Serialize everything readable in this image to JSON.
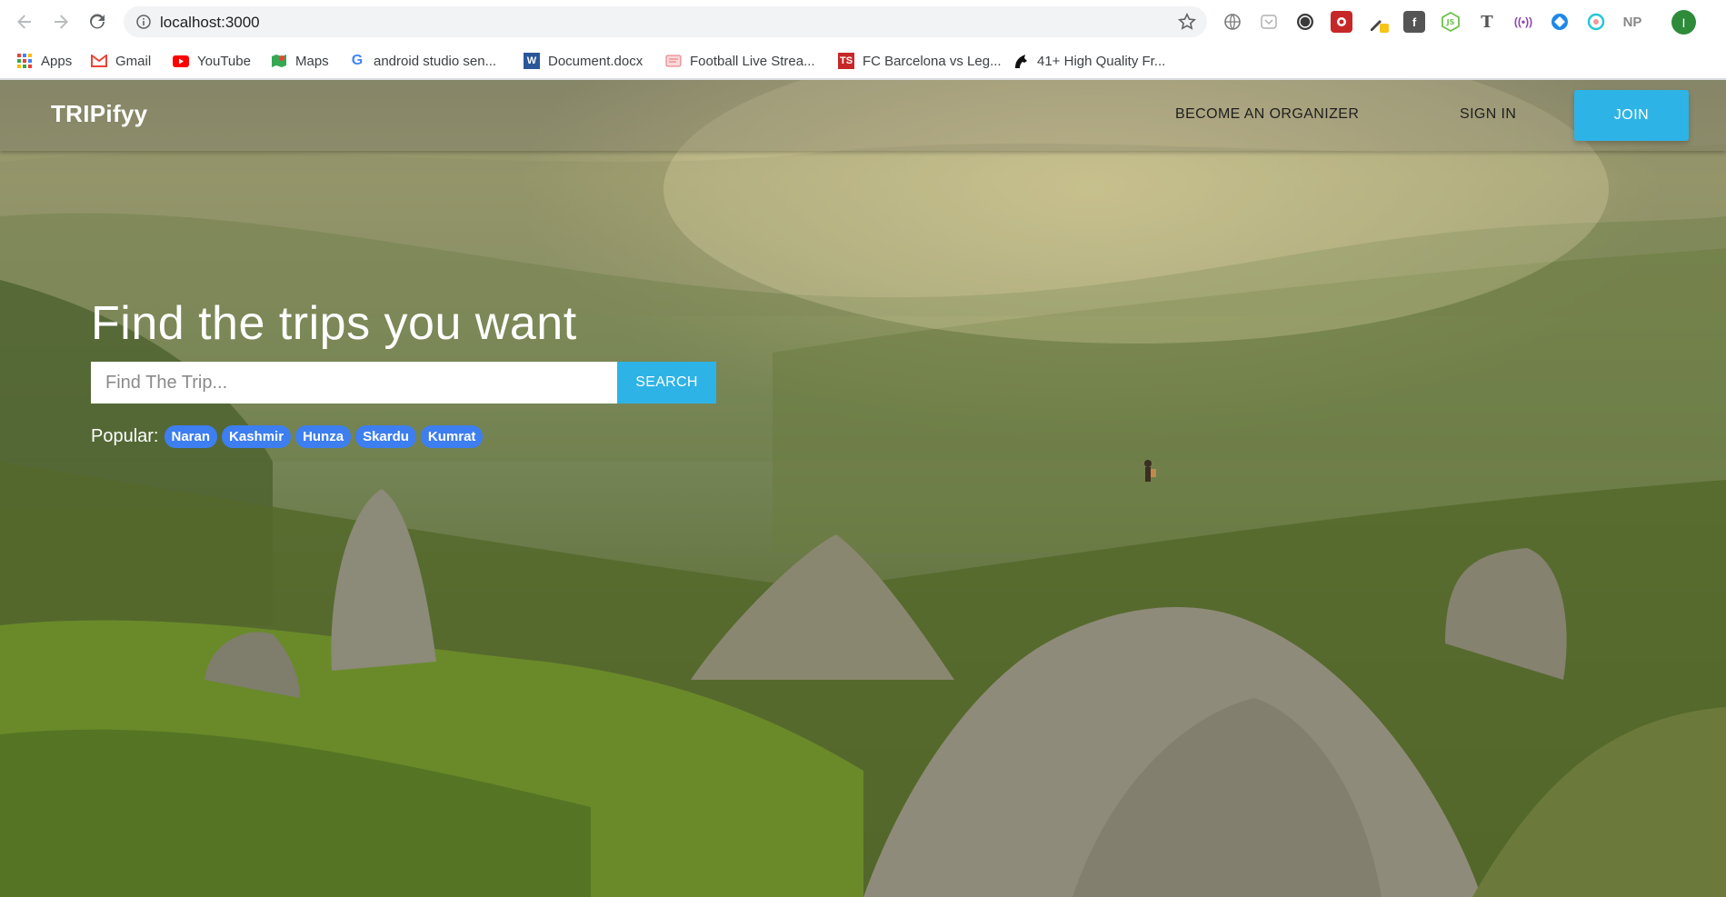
{
  "browser": {
    "url": "localhost:3000",
    "bookmarks": [
      {
        "label": "Apps",
        "icon": "apps-grid-icon"
      },
      {
        "label": "Gmail",
        "icon": "gmail-icon"
      },
      {
        "label": "YouTube",
        "icon": "youtube-icon"
      },
      {
        "label": "Maps",
        "icon": "maps-icon"
      },
      {
        "label": "android studio sen...",
        "icon": "google-icon"
      },
      {
        "label": "Document.docx",
        "icon": "word-icon"
      },
      {
        "label": "Football Live Strea...",
        "icon": "stream-icon"
      },
      {
        "label": "FC Barcelona vs Leg...",
        "icon": "ts-icon"
      },
      {
        "label": "41+ High Quality Fr...",
        "icon": "horse-icon"
      }
    ],
    "profile_initial": "I",
    "extension_np": "NP"
  },
  "site": {
    "brand": "TRIPifyy",
    "nav": {
      "organizer": "BECOME AN ORGANIZER",
      "signin": "SIGN IN",
      "join": "JOIN"
    },
    "hero": {
      "headline": "Find the trips you want",
      "search_placeholder": "Find The Trip...",
      "search_button": "SEARCH",
      "popular_label": "Popular:",
      "popular_tags": [
        "Naran",
        "Kashmir",
        "Hunza",
        "Skardu",
        "Kumrat"
      ]
    },
    "colors": {
      "accent": "#2eb3e6",
      "tag": "#3d7ef0"
    }
  }
}
